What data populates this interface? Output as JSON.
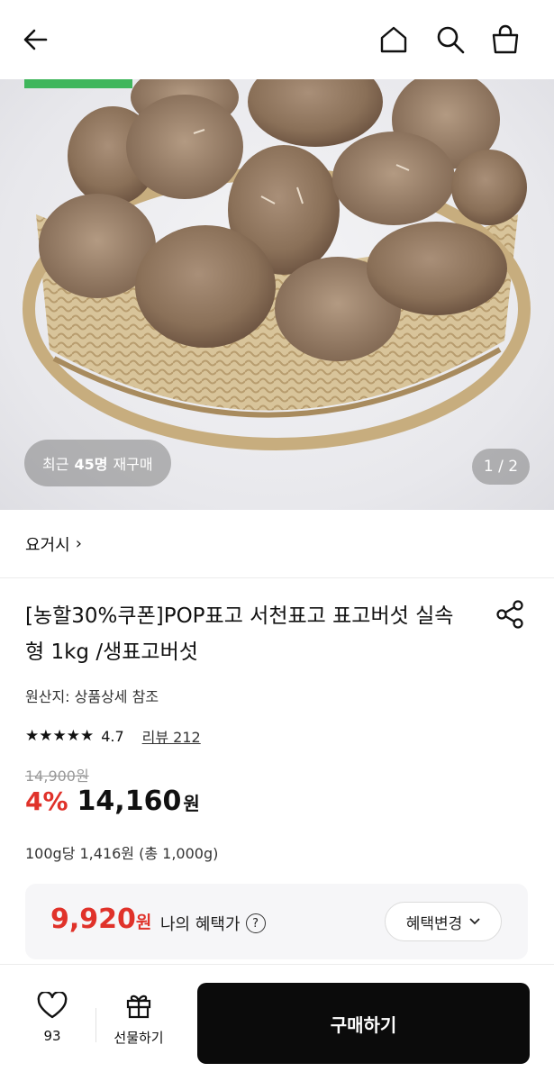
{
  "hero": {
    "repurchase_prefix": "최근",
    "repurchase_count": "45명",
    "repurchase_suffix": "재구매",
    "pager": "1 / 2"
  },
  "shop": {
    "name": "요거시",
    "chevron": "›"
  },
  "product": {
    "title": "[농할30%쿠폰]POP표고 서천표고 표고버섯 실속형 1kg /생표고버섯",
    "origin": "원산지: 상품상세 참조",
    "stars": "★★★★★",
    "rating": "4.7",
    "review_label": "리뷰 212",
    "original_price": "14,900원",
    "discount": "4%",
    "price": "14,160",
    "price_unit": "원",
    "unit_price": "100g당 1,416원 (총 1,000g)"
  },
  "benefit": {
    "price": "9,920",
    "price_unit": "원",
    "label": "나의 혜택가",
    "help": "?",
    "change_label": "혜택변경"
  },
  "bottom": {
    "like_count": "93",
    "gift_label": "선물하기",
    "buy_label": "구매하기"
  },
  "colors": {
    "accent_red": "#e0322a",
    "buy_button": "#0b0b0b",
    "tag_green": "#3fb65c"
  },
  "icons": [
    "back-arrow-icon",
    "home-icon",
    "search-icon",
    "shopping-bag-icon",
    "share-icon",
    "heart-icon",
    "gift-icon",
    "chevron-down-icon",
    "star-icon",
    "question-icon"
  ]
}
